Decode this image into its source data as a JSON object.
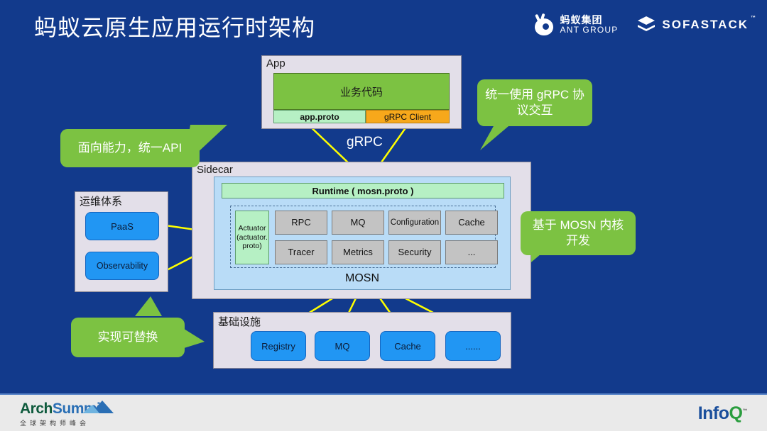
{
  "slide": {
    "title": "蚂蚁云原生应用运行时架构",
    "background_color": "#123a8c",
    "accent_green": "#7cc242",
    "accent_blue": "#2196f3",
    "wire_color": "#ffff00"
  },
  "brands": {
    "ant": {
      "cn": "蚂蚁集团",
      "en": "ANT GROUP",
      "icon": "ant-group-logo-icon"
    },
    "sofastack": {
      "name": "SOFASTACK",
      "tm": "™",
      "icon": "sofastack-logo-icon"
    }
  },
  "app": {
    "label": "App",
    "business_code": "业务代码",
    "app_proto": "app.proto",
    "grpc_client": "gRPC Client",
    "protocol_label": "gRPC"
  },
  "sidecar": {
    "label": "Sidecar",
    "runtime": "Runtime ( mosn.proto )",
    "actuator": "Actuator(actuator.proto)",
    "capabilities_row1": [
      "RPC",
      "MQ",
      "Configuration",
      "Cache"
    ],
    "capabilities_row2": [
      "Tracer",
      "Metrics",
      "Security",
      "..."
    ],
    "engine": "MOSN"
  },
  "ops": {
    "label": "运维体系",
    "items": [
      "PaaS",
      "Observability"
    ]
  },
  "infra": {
    "label": "基础设施",
    "items": [
      "Registry",
      "MQ",
      "Cache",
      "......"
    ]
  },
  "callouts": {
    "grpc": "统一使用 gRPC 协议交互",
    "api": "面向能力，统一API",
    "mosn": "基于 MOSN 内核开发",
    "replaceable": "实现可替换"
  },
  "footer": {
    "archsummit": {
      "arch": "Arch",
      "summit": "Summit",
      "subtitle": "全球架构师峰会"
    },
    "infoq": {
      "info": "Info",
      "q": "Q",
      "tm": "™"
    }
  }
}
